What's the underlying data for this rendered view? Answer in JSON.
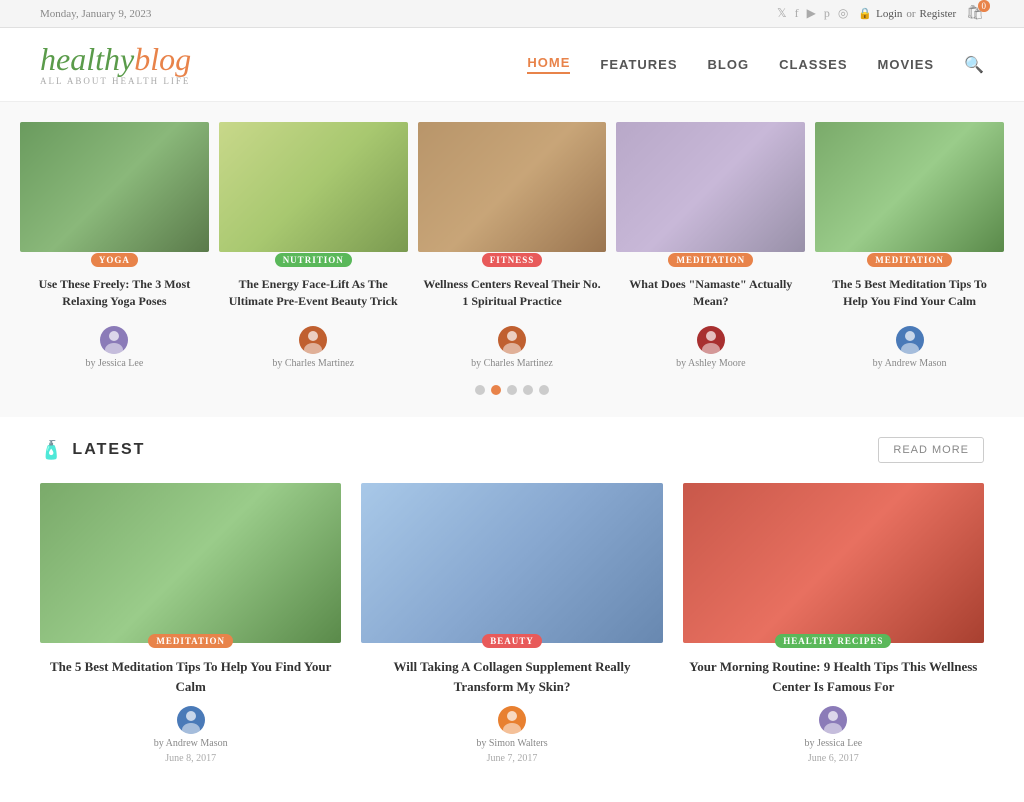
{
  "topbar": {
    "date": "Monday, January 9, 2023",
    "login": "Login",
    "or": "or",
    "register": "Register"
  },
  "logo": {
    "healthy": "healthy",
    "blog": "blog",
    "tagline": "ALL ABOUT HEALTH LIFE"
  },
  "nav": {
    "items": [
      {
        "label": "HOME",
        "active": true
      },
      {
        "label": "FEATURES",
        "active": false
      },
      {
        "label": "BLOG",
        "active": false
      },
      {
        "label": "CLASSES",
        "active": false
      },
      {
        "label": "MOVIES",
        "active": false
      }
    ]
  },
  "carousel": {
    "items": [
      {
        "category": "YOGA",
        "categoryClass": "badge-yoga",
        "title": "Use These Freely: The 3 Most Relaxing Yoga Poses",
        "author": "Jessica Lee",
        "authorClass": "av-jessica",
        "imgClass": "img-yoga"
      },
      {
        "category": "NUTRITION",
        "categoryClass": "badge-nutrition",
        "title": "The Energy Face-Lift As The Ultimate Pre-Event Beauty Trick",
        "author": "Charles Martinez",
        "authorClass": "av-charles",
        "imgClass": "img-nutrition"
      },
      {
        "category": "FITNESS",
        "categoryClass": "badge-fitness",
        "title": "Wellness Centers Reveal Their No. 1 Spiritual Practice",
        "author": "Charles Martinez",
        "authorClass": "av-charlesm",
        "imgClass": "img-fitness"
      },
      {
        "category": "MEDITATION",
        "categoryClass": "badge-meditation",
        "title": "What Does \"Namaste\" Actually Mean?",
        "author": "Ashley Moore",
        "authorClass": "av-ashley",
        "imgClass": "img-meditation1"
      },
      {
        "category": "MEDITATION",
        "categoryClass": "badge-meditation",
        "title": "The 5 Best Meditation Tips To Help You Find Your Calm",
        "author": "Andrew Mason",
        "authorClass": "av-andrew",
        "imgClass": "img-meditation2"
      }
    ],
    "dots": [
      1,
      2,
      3,
      4,
      5
    ],
    "activeDot": 1
  },
  "latest": {
    "sectionTitle": "LATEST",
    "readMoreLabel": "READ MORE",
    "items": [
      {
        "category": "MEDITATION",
        "categoryClass": "badge-meditation",
        "title": "The 5 Best Meditation Tips To Help You Find Your Calm",
        "author": "Andrew Mason",
        "authorClass": "av-andrew",
        "date": "June 8, 2017",
        "imgClass": "img-med",
        "byLabel": "by"
      },
      {
        "category": "BEAUTY",
        "categoryClass": "badge-fitness",
        "title": "Will Taking A Collagen Supplement Really Transform My Skin?",
        "author": "Simon Walters",
        "authorClass": "av-simon",
        "date": "June 7, 2017",
        "imgClass": "img-collagen",
        "byLabel": "by"
      },
      {
        "category": "HEALTHY RECIPES",
        "categoryClass": "badge-nutrition",
        "title": "Your Morning Routine: 9 Health Tips This Wellness Center Is Famous For",
        "author": "Jessica Lee",
        "authorClass": "av-jessica",
        "date": "June 6, 2017",
        "imgClass": "img-routine",
        "byLabel": "by"
      }
    ]
  }
}
